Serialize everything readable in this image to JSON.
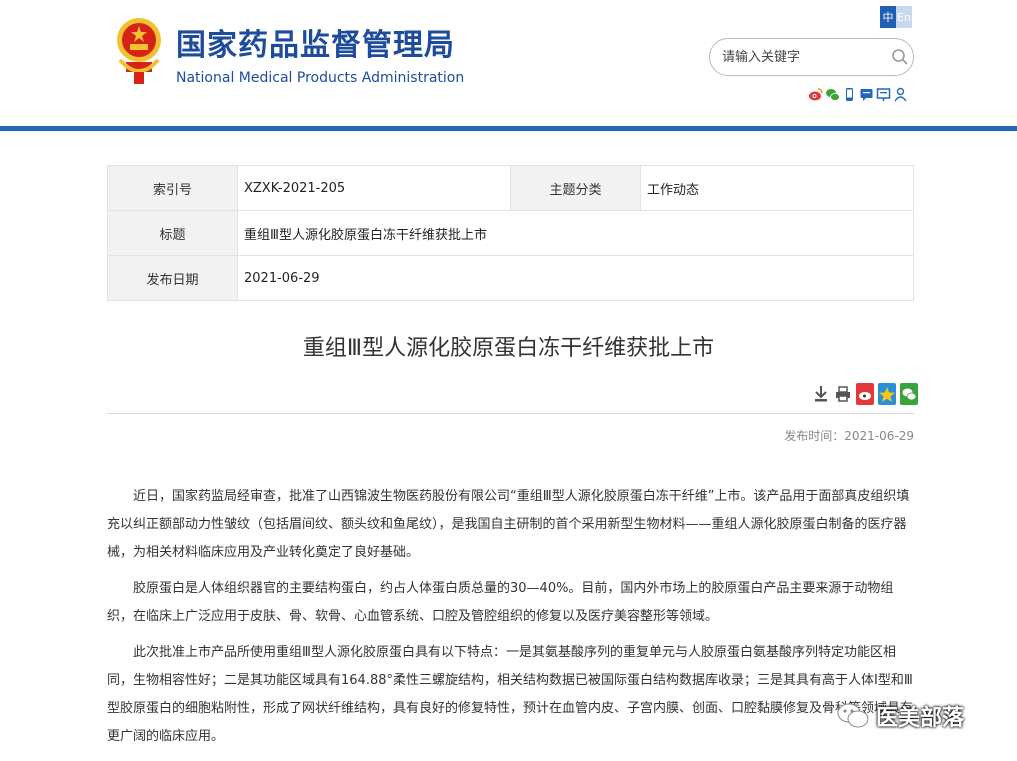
{
  "header": {
    "title_cn": "国家药品监督管理局",
    "title_en": "National Medical Products Administration",
    "lang_zh": "中",
    "lang_en": "En",
    "search_placeholder": "请输入关键字",
    "social_icons": [
      "weibo-icon",
      "wechat-icon",
      "mobile-icon",
      "message-icon",
      "email-icon",
      "user-icon"
    ]
  },
  "info": {
    "index_label": "索引号",
    "index_value": "XZXK-2021-205",
    "category_label": "主题分类",
    "category_value": "工作动态",
    "title_label": "标题",
    "title_value": "重组Ⅲ型人源化胶原蛋白冻干纤维获批上市",
    "date_label": "发布日期",
    "date_value": "2021-06-29"
  },
  "article": {
    "title": "重组Ⅲ型人源化胶原蛋白冻干纤维获批上市",
    "published": "发布时间：2021-06-29",
    "paragraphs": [
      "近日，国家药监局经审查，批准了山西锦波生物医药股份有限公司“重组Ⅲ型人源化胶原蛋白冻干纤维”上市。该产品用于面部真皮组织填充以纠正额部动力性皱纹（包括眉间纹、额头纹和鱼尾纹），是我国自主研制的首个采用新型生物材料——重组人源化胶原蛋白制备的医疗器械，为相关材料临床应用及产业转化奠定了良好基础。",
      "胶原蛋白是人体组织器官的主要结构蛋白，约占人体蛋白质总量的30—40%。目前，国内外市场上的胶原蛋白产品主要来源于动物组织，在临床上广泛应用于皮肤、骨、软骨、心血管系统、口腔及管腔组织的修复以及医疗美容整形等领域。",
      "此次批准上市产品所使用重组Ⅲ型人源化胶原蛋白具有以下特点：一是其氨基酸序列的重复单元与人胶原蛋白氨基酸序列特定功能区相同，生物相容性好；二是其功能区域具有164.88°柔性三螺旋结构，相关结构数据已被国际蛋白结构数据库收录；三是其具有高于人体Ⅰ型和Ⅲ型胶原蛋白的细胞粘附性，形成了网状纤维结构，具有良好的修复特性，预计在血管内皮、子宫内膜、创面、口腔黏膜修复及骨科等领域具有更广阔的临床应用。"
    ]
  },
  "watermark": {
    "text": "医美部落"
  },
  "colors": {
    "brand_blue": "#1d4c9c",
    "bar_blue": "#2467b8",
    "emblem_red": "#d7221a",
    "emblem_gold": "#f2c230"
  }
}
